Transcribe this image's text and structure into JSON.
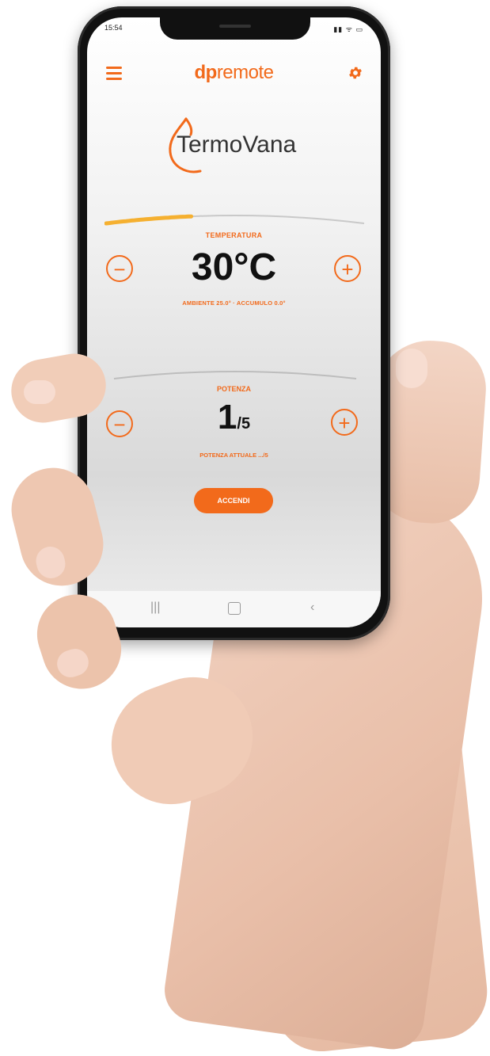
{
  "status_bar": {
    "time": "15:54",
    "icons": "▮▮ ᯤ ▭"
  },
  "header": {
    "brand_dp": "dp",
    "brand_remote": "remote"
  },
  "logo": {
    "text": "TermoVana"
  },
  "temperature": {
    "label": "TEMPERATURA",
    "value": "30°C",
    "detail": "AMBIENTE 25.0° · ACCUMULO 0.0°",
    "minus": "−",
    "plus": "+",
    "level": 0.33
  },
  "power": {
    "label": "POTENZA",
    "value": "1",
    "unit": "/5",
    "detail": "POTENZA ATTUALE .../5",
    "minus": "−",
    "plus": "+"
  },
  "action": {
    "on_label": "ACCENDI"
  },
  "navbar": {
    "recents": "|||",
    "back": "‹"
  },
  "colors": {
    "accent": "#f26a1b",
    "temp_fill": "#f5b030"
  }
}
